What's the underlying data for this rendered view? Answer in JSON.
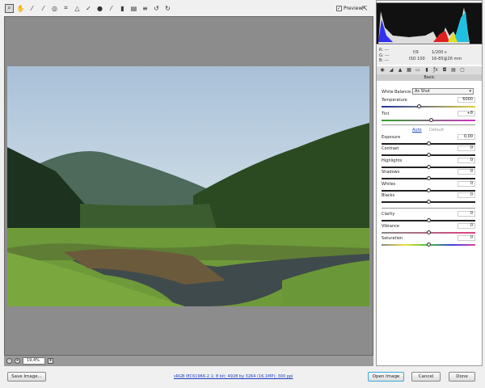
{
  "toolbar": {
    "tools": [
      "zoom-icon",
      "hand-icon",
      "white-balance-icon",
      "color-sampler-icon",
      "target-adjust-icon",
      "crop-icon",
      "straighten-icon",
      "spot-removal-icon",
      "red-eye-icon",
      "adjustment-brush-icon",
      "graduated-filter-icon",
      "radial-filter-icon",
      "preferences-icon",
      "rotate-ccw-icon",
      "rotate-cw-icon"
    ],
    "preview_label": "Preview",
    "preview_checked": true
  },
  "info": {
    "r": "R: ---",
    "g": "G: ---",
    "b": "B: ---",
    "aperture": "f/9",
    "shutter": "1/200 s",
    "iso": "ISO 100",
    "lens": "16-85@26 mm"
  },
  "panel": {
    "title": "Basic",
    "wb_label": "White Balance:",
    "wb_value": "As Shot",
    "auto": "Auto",
    "default": "Default",
    "sliders": [
      {
        "label": "Temperature",
        "value": "6000",
        "pos": 0.4
      },
      {
        "label": "Tint",
        "value": "+8",
        "pos": 0.53
      },
      {
        "label": "Exposure",
        "value": "0,00",
        "pos": 0.5
      },
      {
        "label": "Contrast",
        "value": "0",
        "pos": 0.5
      },
      {
        "label": "Highlights",
        "value": "0",
        "pos": 0.5
      },
      {
        "label": "Shadows",
        "value": "0",
        "pos": 0.5
      },
      {
        "label": "Whites",
        "value": "0",
        "pos": 0.5
      },
      {
        "label": "Blacks",
        "value": "0",
        "pos": 0.5
      },
      {
        "label": "Clarity",
        "value": "0",
        "pos": 0.5
      },
      {
        "label": "Vibrance",
        "value": "0",
        "pos": 0.5
      },
      {
        "label": "Saturation",
        "value": "0",
        "pos": 0.5
      }
    ]
  },
  "zoom": {
    "value": "19,4%"
  },
  "footer": {
    "save": "Save Image...",
    "status": "sRGB IEC61966-2.1; 8 bit; 4928 by 3264 (16,1MP); 300 ppi",
    "open": "Open Image",
    "cancel": "Cancel",
    "done": "Done"
  }
}
